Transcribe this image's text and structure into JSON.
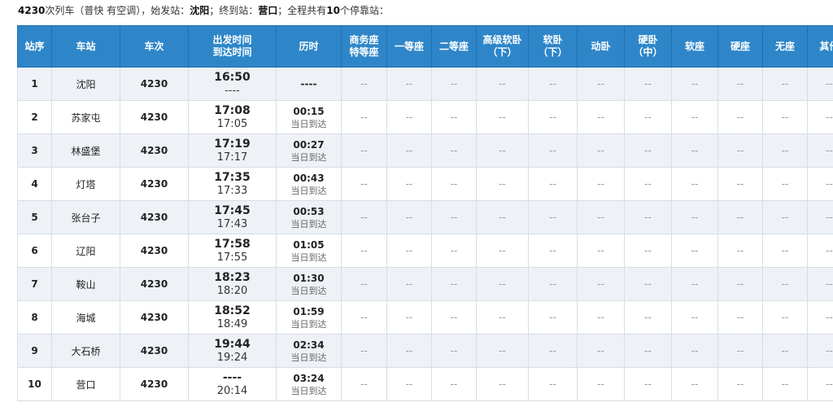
{
  "summary": {
    "train_no": "4230",
    "text1": "次列车（普快 有空调），始发站：",
    "origin": "沈阳",
    "text2": "；终到站：",
    "terminal": "营口",
    "text3": "；全程共有",
    "stop_count": "10",
    "text4": "个停靠站："
  },
  "headers": {
    "seq": "站序",
    "station": "车站",
    "train": "车次",
    "time_dep": "出发时间",
    "time_arr": "到达时间",
    "duration": "历时",
    "business_1": "商务座",
    "business_2": "特等座",
    "first": "一等座",
    "second": "二等座",
    "soft_sleeper_adv_1": "高级软卧",
    "soft_sleeper_adv_2": "（下）",
    "soft_sleeper_1": "软卧",
    "soft_sleeper_2": "（下）",
    "motor_sleeper": "动卧",
    "hard_sleeper_1": "硬卧",
    "hard_sleeper_2": "（中）",
    "soft_seat": "软座",
    "hard_seat": "硬座",
    "no_seat": "无座",
    "other": "其他"
  },
  "seat_placeholder": "--",
  "rows": [
    {
      "seq": "1",
      "station": "沈阳",
      "train": "4230",
      "depart": "16:50",
      "arrive": "----",
      "duration": "----",
      "duration_note": ""
    },
    {
      "seq": "2",
      "station": "苏家屯",
      "train": "4230",
      "depart": "17:08",
      "arrive": "17:05",
      "duration": "00:15",
      "duration_note": "当日到达"
    },
    {
      "seq": "3",
      "station": "林盛堡",
      "train": "4230",
      "depart": "17:19",
      "arrive": "17:17",
      "duration": "00:27",
      "duration_note": "当日到达"
    },
    {
      "seq": "4",
      "station": "灯塔",
      "train": "4230",
      "depart": "17:35",
      "arrive": "17:33",
      "duration": "00:43",
      "duration_note": "当日到达"
    },
    {
      "seq": "5",
      "station": "张台子",
      "train": "4230",
      "depart": "17:45",
      "arrive": "17:43",
      "duration": "00:53",
      "duration_note": "当日到达"
    },
    {
      "seq": "6",
      "station": "辽阳",
      "train": "4230",
      "depart": "17:58",
      "arrive": "17:55",
      "duration": "01:05",
      "duration_note": "当日到达"
    },
    {
      "seq": "7",
      "station": "鞍山",
      "train": "4230",
      "depart": "18:23",
      "arrive": "18:20",
      "duration": "01:30",
      "duration_note": "当日到达"
    },
    {
      "seq": "8",
      "station": "海城",
      "train": "4230",
      "depart": "18:52",
      "arrive": "18:49",
      "duration": "01:59",
      "duration_note": "当日到达"
    },
    {
      "seq": "9",
      "station": "大石桥",
      "train": "4230",
      "depart": "19:44",
      "arrive": "19:24",
      "duration": "02:34",
      "duration_note": "当日到达"
    },
    {
      "seq": "10",
      "station": "营口",
      "train": "4230",
      "depart": "----",
      "arrive": "20:14",
      "duration": "03:24",
      "duration_note": "当日到达"
    }
  ],
  "colors": {
    "header_bg": "#2e86c9",
    "row_alt_bg": "#eef2f7"
  }
}
